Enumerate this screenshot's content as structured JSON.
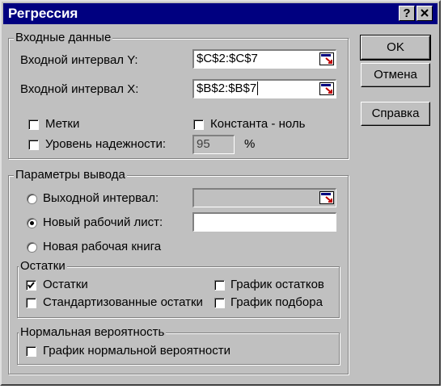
{
  "window": {
    "title": "Регрессия",
    "help_btn": "?",
    "close_btn": "✕"
  },
  "input_group": {
    "legend": "Входные данные",
    "y_label": "Входной интервал Y:",
    "y_value": "$C$2:$C$7",
    "x_label": "Входной интервал X:",
    "x_value": "$B$2:$B$7",
    "labels_checkbox": "Метки",
    "labels_checked": false,
    "constant_zero_checkbox": "Константа - ноль",
    "constant_zero_checked": false,
    "confidence_checkbox": "Уровень надежности:",
    "confidence_checked": false,
    "confidence_value": "95",
    "percent": "%"
  },
  "output_group": {
    "legend": "Параметры вывода",
    "output_range_label": "Выходной интервал:",
    "output_range_value": "",
    "new_sheet_label": "Новый рабочий лист:",
    "new_sheet_value": "",
    "new_workbook_label": "Новая рабочая книга",
    "selected": "new_sheet"
  },
  "residuals_group": {
    "legend": "Остатки",
    "residuals": "Остатки",
    "residuals_checked": true,
    "std_residuals": "Стандартизованные остатки",
    "std_residuals_checked": false,
    "residual_plot": "График остатков",
    "residual_plot_checked": false,
    "fit_plot": "График подбора",
    "fit_plot_checked": false
  },
  "normal_group": {
    "legend": "Нормальная вероятность",
    "normal_plot": "График нормальной вероятности",
    "normal_plot_checked": false
  },
  "buttons": {
    "ok": "OK",
    "cancel": "Отмена",
    "help": "Справка"
  }
}
